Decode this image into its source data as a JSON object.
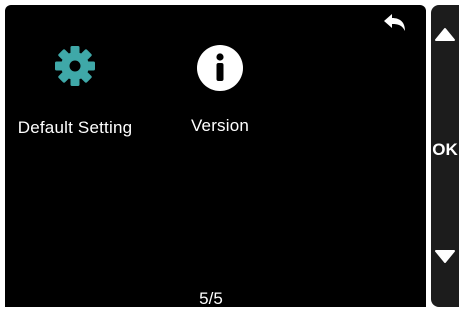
{
  "menu": {
    "items": [
      {
        "label": "Default Setting",
        "icon": "gear-icon"
      },
      {
        "label": "Version",
        "icon": "info-icon"
      }
    ]
  },
  "pagination": {
    "label": "5/5"
  },
  "side_panel": {
    "ok_label": "OK",
    "up_icon": "triangle-up-icon",
    "down_icon": "triangle-down-icon"
  },
  "header": {
    "back_icon": "back-arrow-icon"
  },
  "colors": {
    "background": "#000000",
    "gear": "#3fa8a8",
    "text": "#ffffff",
    "side_panel": "#1c1c1c"
  }
}
